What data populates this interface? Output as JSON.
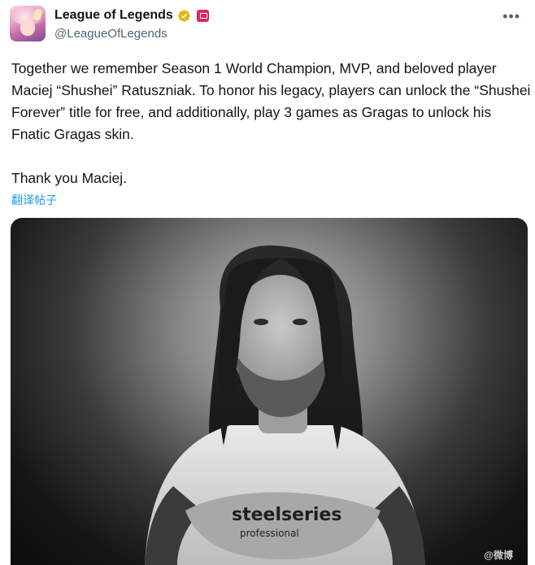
{
  "account": {
    "display_name": "League of Legends",
    "handle": "@LeagueOfLegends",
    "verified_badge_color": "#e2b719",
    "affiliate_badge_color": "#e0245e"
  },
  "menu": {
    "more_label": "•••"
  },
  "tweet": {
    "text": "Together we remember Season 1 World Champion, MVP, and beloved player Maciej “Shushei” Ratuszniak. To honor his legacy, players can unlock the “Shushei Forever” title for free, and additionally, play 3 games as Gragas to unlock his Fnatic Gragas skin.\n\nThank you Maciej.",
    "translate_label": "翻译帖子"
  },
  "media": {
    "shirt_text": "steelseries",
    "shirt_subtext": "professional",
    "watermark": "@微博"
  },
  "colors": {
    "link": "#1d9bf0",
    "secondary_text": "#536471",
    "primary_text": "#0f1419"
  }
}
